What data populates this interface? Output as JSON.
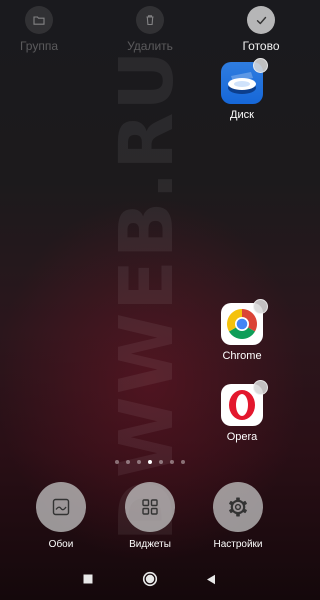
{
  "watermark": "DWWEB.RU",
  "top_bar": {
    "group_label": "Группа",
    "delete_label": "Удалить",
    "done_label": "Готово"
  },
  "apps": [
    {
      "name": "Диск",
      "icon": "yandex-disk-icon",
      "selected": false
    },
    {
      "name": "Chrome",
      "icon": "chrome-icon",
      "selected": false
    },
    {
      "name": "Opera",
      "icon": "opera-icon",
      "selected": false
    }
  ],
  "pager": {
    "pages": 7,
    "current": 3
  },
  "options": {
    "wallpapers_label": "Обои",
    "widgets_label": "Виджеты",
    "settings_label": "Настройки"
  },
  "navbar": {
    "recents_icon": "square-icon",
    "home_icon": "circle-icon",
    "back_icon": "triangle-back-icon"
  },
  "colors": {
    "disk_blue": "#1667d8",
    "opera_red": "#e3172d",
    "chrome_red": "#db4437",
    "chrome_yellow": "#f4c20d",
    "chrome_green": "#0f9d58",
    "chrome_blue": "#4285f4"
  }
}
